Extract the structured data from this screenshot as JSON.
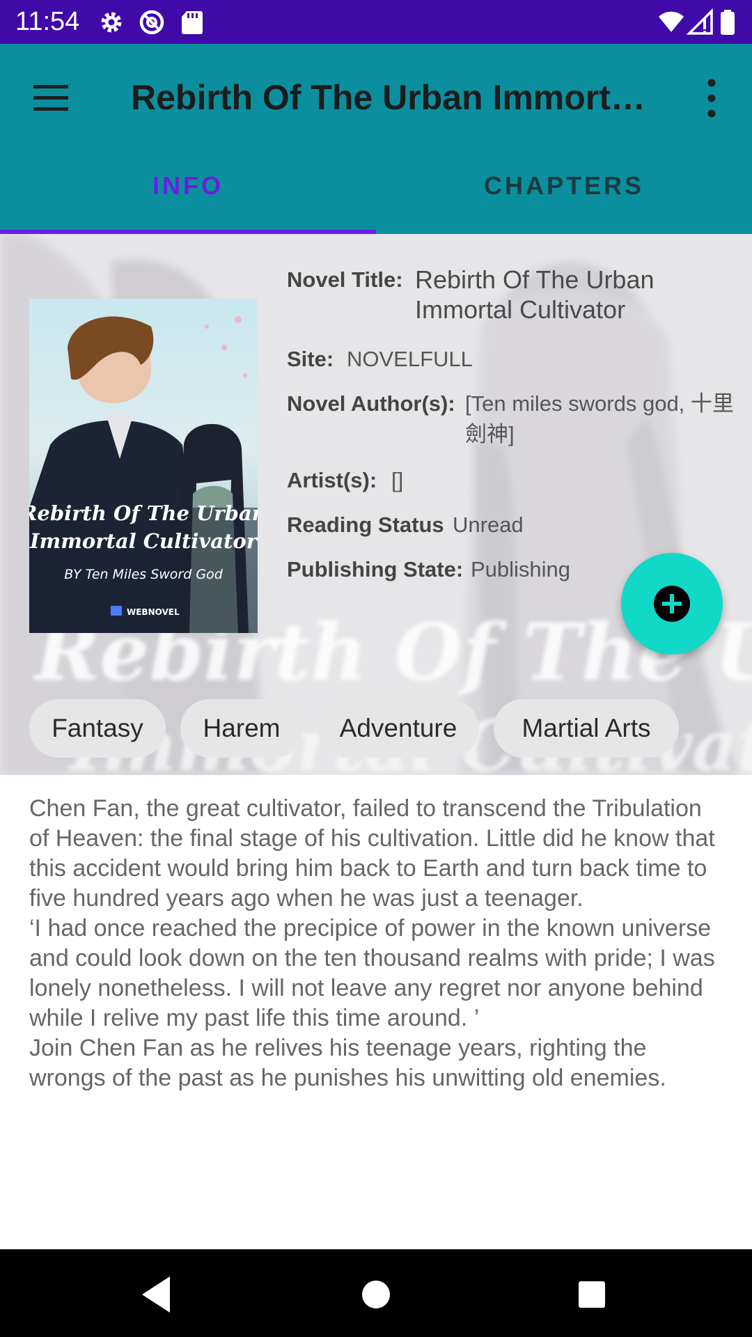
{
  "status_bar": {
    "time": "11:54",
    "left_icons": [
      "gear-icon",
      "at-sign-icon",
      "sd-card-icon"
    ],
    "right_icons": [
      "wifi-icon",
      "cell-signal-icon",
      "battery-icon"
    ]
  },
  "app_bar": {
    "title": "Rebirth Of The Urban Immortal Cultivator",
    "menu_icon": "hamburger-menu-icon",
    "more_icon": "more-vert-icon",
    "color": "#0b8f9e"
  },
  "tabs": [
    {
      "label": "INFO",
      "selected": true
    },
    {
      "label": "CHAPTERS",
      "selected": false
    }
  ],
  "novel": {
    "cover_title_line1": "Rebirth Of The Urban",
    "cover_title_line2": "Immortal Cultivator",
    "cover_byline": "BY Ten Miles Sword God",
    "cover_publisher": "WEBNOVEL",
    "background_text_line1": "Rebirth Of The Urban",
    "background_text_line2": "Immortal Cultivator",
    "fields": {
      "title_label": "Novel Title:",
      "title_value": "Rebirth Of The Urban Immortal Cultivator",
      "site_label": "Site:",
      "site_value": "NOVELFULL",
      "author_label": "Novel Author(s):",
      "author_value": "[Ten miles swords god, 十里劍神]",
      "artist_label": "Artist(s):",
      "artist_value": "[]",
      "reading_status_label": "Reading Status",
      "reading_status_value": "Unread",
      "publishing_state_label": "Publishing State:",
      "publishing_state_value": "Publishing"
    },
    "genres": [
      "Fantasy",
      "Harem",
      "Adventure",
      "Martial Arts"
    ],
    "description": "Chen Fan, the great cultivator, failed to transcend the Tribulation of Heaven: the final stage of his cultivation. Little did he know that this accident would bring him back to Earth and turn back time to five hundred years ago when he was just a teenager.\n‘I had once reached the precipice of power in the known universe and could look down on the ten thousand realms with pride; I was lonely nonetheless. I will not leave any regret nor anyone behind while I relive my past life this time around. ’\nJoin Chen Fan as he relives his teenage years, righting the wrongs of the past as he punishes his unwitting old enemies."
  },
  "fab": {
    "icon": "add-circle-icon",
    "color": "#12d8c8"
  },
  "nav_bar": {
    "icons": [
      "back-triangle-icon",
      "home-circle-icon",
      "recents-square-icon"
    ]
  }
}
